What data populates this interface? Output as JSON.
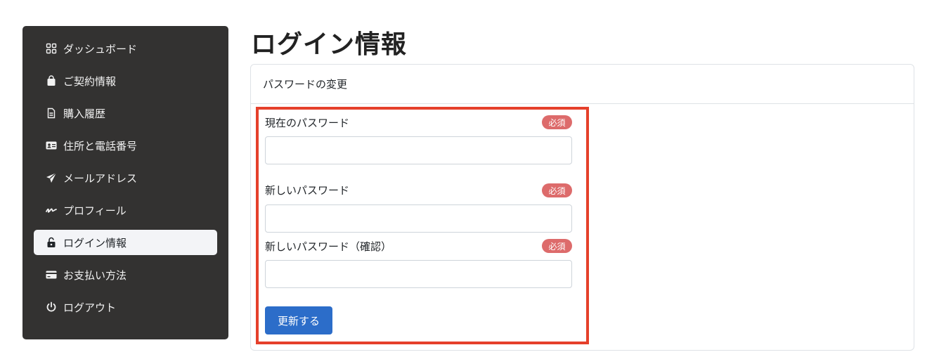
{
  "sidebar": {
    "items": [
      {
        "label": "ダッシュボード",
        "icon": "dashboard-icon"
      },
      {
        "label": "ご契約情報",
        "icon": "shopping-bag-icon"
      },
      {
        "label": "購入履歴",
        "icon": "document-icon"
      },
      {
        "label": "住所と電話番号",
        "icon": "id-card-icon"
      },
      {
        "label": "メールアドレス",
        "icon": "send-icon"
      },
      {
        "label": "プロフィール",
        "icon": "signature-icon"
      },
      {
        "label": "ログイン情報",
        "icon": "unlock-icon",
        "active": true
      },
      {
        "label": "お支払い方法",
        "icon": "credit-card-icon"
      },
      {
        "label": "ログアウト",
        "icon": "power-icon"
      }
    ]
  },
  "page": {
    "title": "ログイン情報"
  },
  "card": {
    "header": "パスワードの変更",
    "required_label": "必須",
    "fields": [
      {
        "label": "現在のパスワード",
        "value": "",
        "placeholder": ""
      },
      {
        "label": "新しいパスワード",
        "value": "",
        "placeholder": ""
      },
      {
        "label": "新しいパスワード（確認）",
        "value": "",
        "placeholder": ""
      }
    ],
    "submit_label": "更新する"
  },
  "colors": {
    "sidebar_bg": "#333231",
    "active_bg": "#f3f4f7",
    "badge": "#dd6b6b",
    "primary": "#2c6dc9",
    "highlight": "#e5402b"
  }
}
